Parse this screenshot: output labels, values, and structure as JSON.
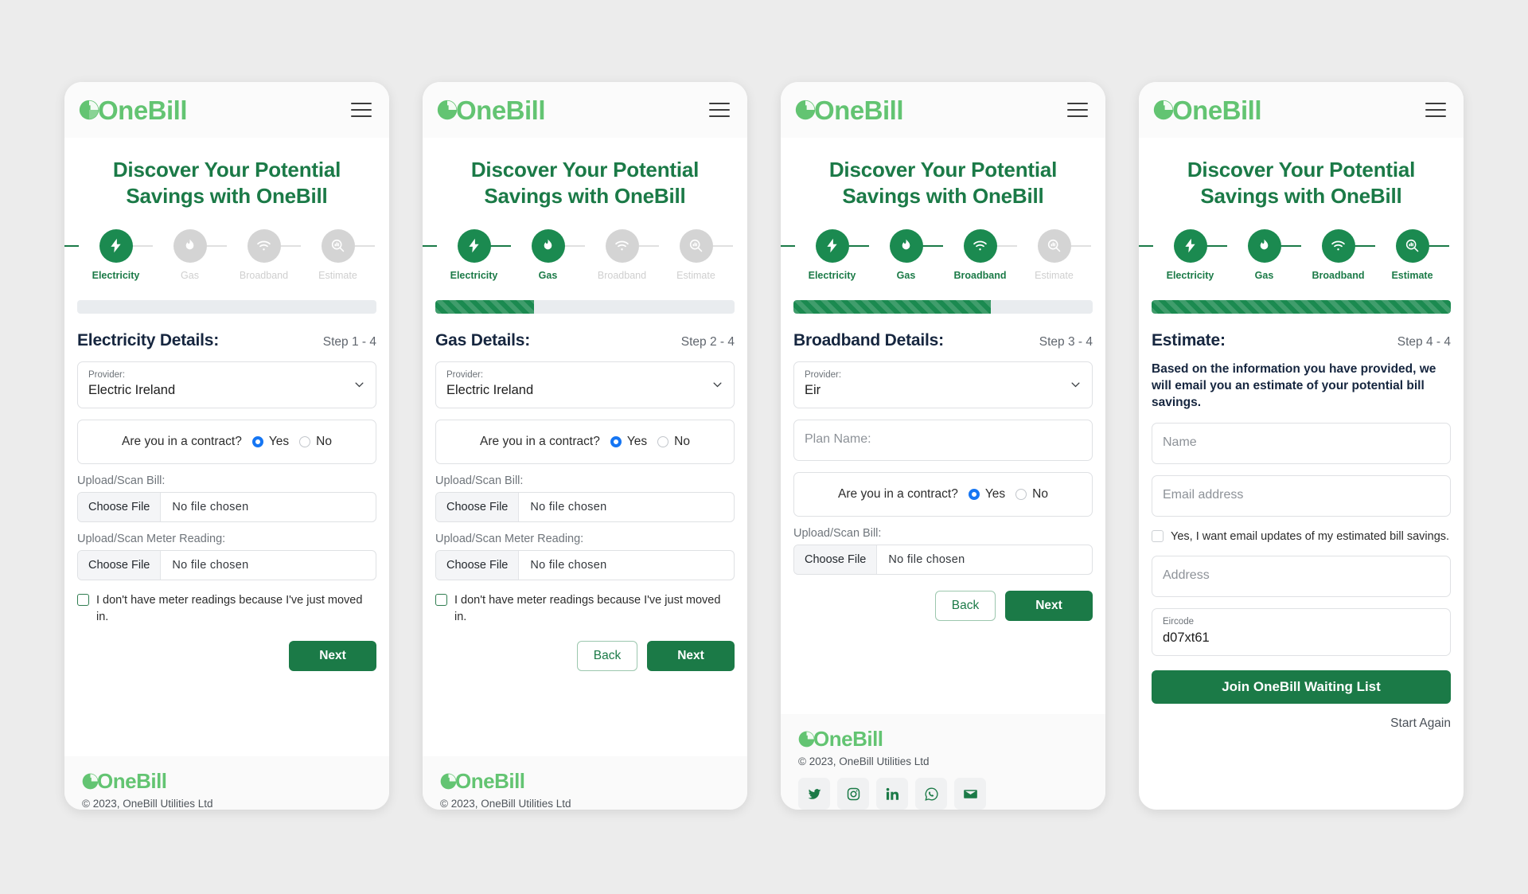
{
  "brand": {
    "name": "OneBill",
    "logo_green": "#63c472",
    "primary_green": "#1b7a47",
    "accent_blue": "#1676f3",
    "title_navy": "#16263f"
  },
  "headline": "Discover Your Potential Savings with OneBill",
  "steps": [
    "Electricity",
    "Gas",
    "Broadband",
    "Estimate"
  ],
  "step_icons": [
    "bolt-icon",
    "flame-icon",
    "wifi-icon",
    "estimate-chart-search-icon"
  ],
  "common": {
    "provider_label": "Provider:",
    "contract_question": "Are you in a contract?",
    "radio_yes": "Yes",
    "radio_no": "No",
    "upload_bill_label": "Upload/Scan Bill:",
    "upload_meter_label": "Upload/Scan Meter Reading:",
    "choose_file": "Choose File",
    "no_file_chosen": "No file chosen",
    "no_meter_checkbox": "I don't have meter readings because I've just moved in.",
    "next": "Next",
    "back": "Back",
    "menu": "hamburger-menu-icon"
  },
  "footer": {
    "copyright": "© 2023, OneBill Utilities Ltd",
    "socials": [
      "twitter-icon",
      "instagram-icon",
      "linkedin-icon",
      "whatsapp-icon",
      "email-icon"
    ]
  },
  "panels": [
    {
      "id": "panel-electricity",
      "section_title": "Electricity Details:",
      "step_label": "Step 1 - 4",
      "active_step": 1,
      "progress_percent": 0,
      "provider_value": "Electric Ireland",
      "contract_selected": "Yes"
    },
    {
      "id": "panel-gas",
      "section_title": "Gas Details:",
      "step_label": "Step 2 - 4",
      "active_step": 2,
      "progress_percent": 33,
      "provider_value": "Electric Ireland",
      "contract_selected": "Yes"
    },
    {
      "id": "panel-broadband",
      "section_title": "Broadband Details:",
      "step_label": "Step 3 - 4",
      "active_step": 3,
      "progress_percent": 66,
      "provider_value": "Eir",
      "plan_name_placeholder": "Plan Name:",
      "contract_selected": "Yes"
    },
    {
      "id": "panel-estimate",
      "section_title": "Estimate:",
      "step_label": "Step 4 - 4",
      "active_step": 4,
      "progress_percent": 100,
      "estimate_note": "Based on the information you have provided, we will email you an estimate of your potential bill savings.",
      "name_placeholder": "Name",
      "email_placeholder": "Email address",
      "email_updates_checkbox": "Yes, I want email updates of my estimated bill savings.",
      "address_placeholder": "Address",
      "eircode_label": "Eircode",
      "eircode_value": "d07xt61",
      "submit_label": "Join OneBill Waiting List",
      "start_again": "Start Again"
    }
  ]
}
